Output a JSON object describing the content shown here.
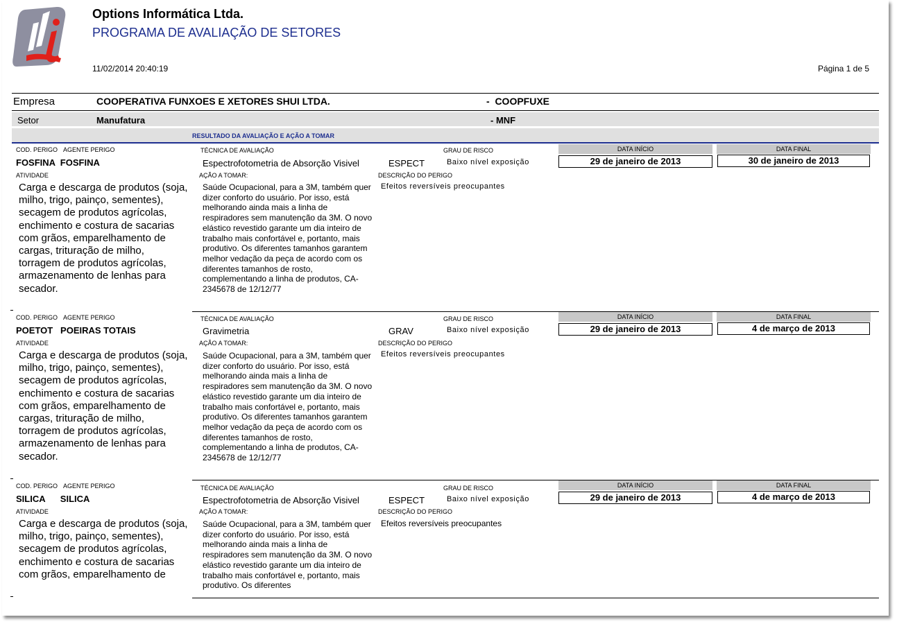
{
  "header": {
    "company_name": "Options Informática Ltda.",
    "program_title": "PROGRAMA DE AVALIAÇÃO DE SETORES",
    "datetime": "11/02/2014 20:40:19",
    "page_indicator": "Página 1 de 5"
  },
  "empresa": {
    "label": "Empresa",
    "name": "COOPERATIVA FUNXOES E XETORES SHUI LTDA.",
    "code": "-  COOPFUXE"
  },
  "setor": {
    "label": "Setor",
    "name": "Manufatura",
    "code": "- MNF"
  },
  "section_title": "RESULTADO DA AVALIAÇÃO E AÇÃO A TOMAR",
  "labels": {
    "cod_perigo": "COD. PERIGO",
    "agente_perigo": "AGENTE PERIGO",
    "atividade": "ATIVIDADE",
    "tecnica": "TÉCNICA DE AVALIAÇÃO",
    "grau": "GRAU DE RISCO",
    "acao": "AÇÃO A TOMAR:",
    "descricao": "DESCRIÇÃO DO PERIGO",
    "data_inicio": "DATA INÍCIO",
    "data_final": "DATA FINAL"
  },
  "records": [
    {
      "cod_agente": "FOSFINA  FOSFINA",
      "atividade": "Carga e descarga de produtos (soja, milho, trigo, painço, sementes), secagem de produtos agrícolas, enchimento e costura de sacarias com grãos, emparelhamento de cargas, trituração de milho, torragem de produtos agrícolas, armazenamento de lenhas para secador.",
      "tecnica": "Espectrofotometria de Absorção Visivel",
      "tecnica_code": "ESPECT",
      "grau": "Baixo nível exposição",
      "acao": "Saúde Ocupacional, para a 3M, também quer dizer conforto do usuário. Por isso, está melhorando ainda mais a linha de respiradores sem manutenção da 3M. O novo elástico revestido garante um dia inteiro de trabalho mais confortável e, portanto, mais produtivo. Os diferentes tamanhos garantem melhor vedação da peça de acordo com os diferentes tamanhos de rosto, complementando a linha de produtos, CA-2345678 de 12/12/77",
      "descricao": "Efeitos reversíveis preocupantes",
      "data_inicio": "29  de janeiro de 2013",
      "data_final": "30  de janeiro de 2013"
    },
    {
      "cod_agente": "POETOT   POEIRAS TOTAIS",
      "atividade": "Carga e descarga de produtos (soja, milho, trigo, painço, sementes), secagem de produtos agrícolas, enchimento e costura de sacarias com grãos, emparelhamento de cargas, trituração de milho, torragem de produtos agrícolas, armazenamento de lenhas para secador.",
      "tecnica": "Gravimetria",
      "tecnica_code": "GRAV",
      "grau": "Baixo nível exposição",
      "acao": "Saúde Ocupacional, para a 3M, também quer dizer conforto do usuário. Por isso, está melhorando ainda mais a linha de respiradores sem manutenção da 3M. O novo elástico revestido garante um dia inteiro de trabalho mais confortável e, portanto, mais produtivo. Os diferentes tamanhos garantem melhor vedação da peça de acordo com os diferentes tamanhos de rosto, complementando a linha de produtos, CA-2345678 de 12/12/77",
      "descricao": "Efeitos reversíveis preocupantes",
      "data_inicio": "29  de janeiro de 2013",
      "data_final": "4  de março de 2013"
    },
    {
      "cod_agente": "SILICA      SILICA",
      "atividade": "Carga e descarga de produtos (soja, milho, trigo, painço, sementes), secagem de produtos agrícolas, enchimento e costura de sacarias com grãos, emparelhamento de",
      "tecnica": "Espectrofotometria de Absorção Visivel",
      "tecnica_code": "ESPECT",
      "grau": "Baixo nível exposição",
      "acao": "Saúde Ocupacional, para a 3M, também quer dizer conforto do usuário. Por isso, está melhorando ainda mais a linha de respiradores sem manutenção da 3M. O novo elástico revestido garante um dia inteiro de trabalho mais confortável e, portanto, mais produtivo. Os diferentes",
      "descricao": "Efeitos reversíveis preocupantes",
      "data_inicio": "29  de janeiro de 2013",
      "data_final": "4  de março de 2013"
    }
  ]
}
